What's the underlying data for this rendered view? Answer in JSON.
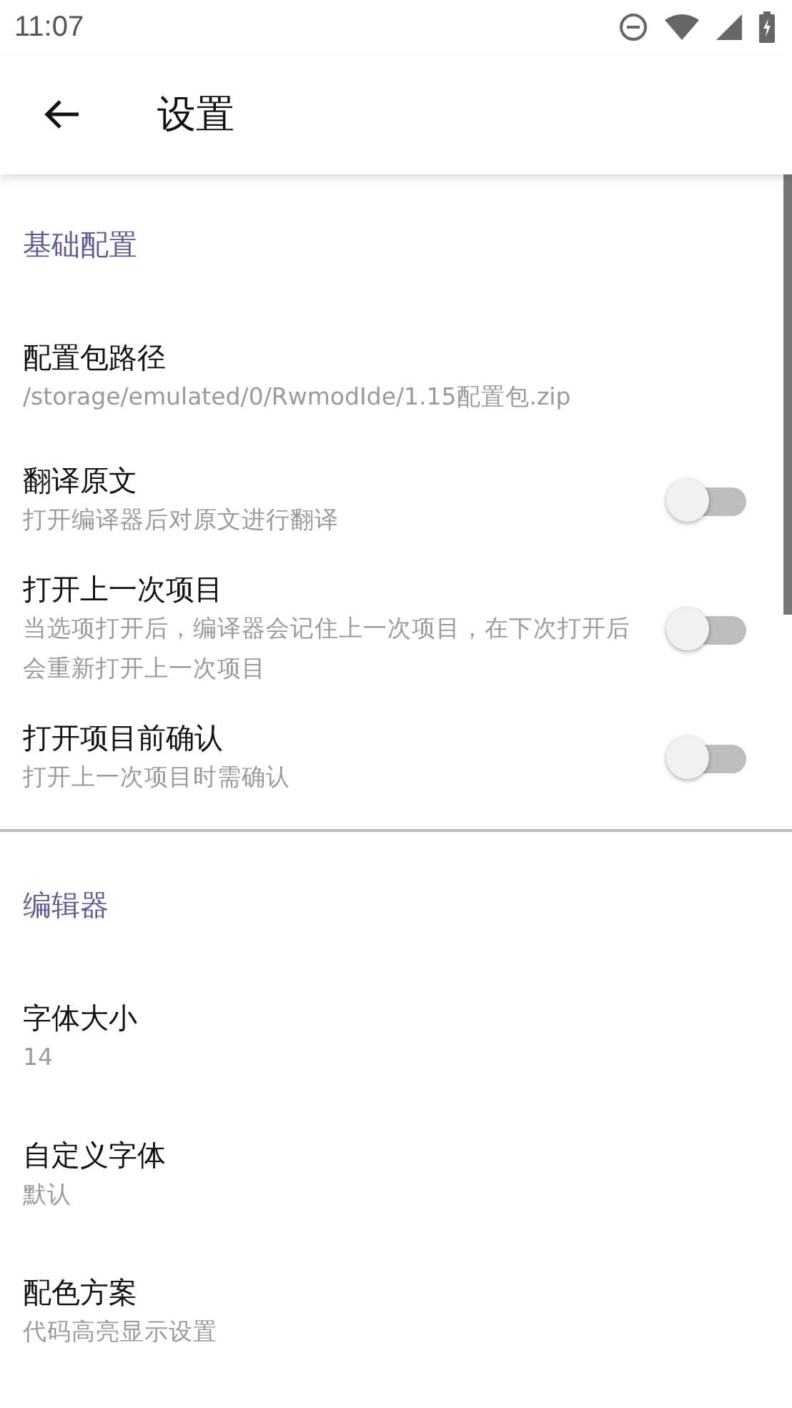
{
  "status_bar": {
    "time": "11:07"
  },
  "app_bar": {
    "title": "设置"
  },
  "sections": [
    {
      "title": "基础配置",
      "items": [
        {
          "kind": "text",
          "title": "配置包路径",
          "summary": "/storage/emulated/0/RwmodIde/1.15配置包.zip"
        },
        {
          "kind": "switch",
          "title": "翻译原文",
          "summary": "打开编译器后对原文进行翻译",
          "on": false
        },
        {
          "kind": "switch",
          "title": "打开上一次项目",
          "summary": "当选项打开后，编译器会记住上一次项目，在下次打开后会重新打开上一次项目",
          "on": false
        },
        {
          "kind": "switch",
          "title": "打开项目前确认",
          "summary": "打开上一次项目时需确认",
          "on": false
        }
      ]
    },
    {
      "title": "编辑器",
      "items": [
        {
          "kind": "text",
          "title": "字体大小",
          "summary": "14"
        },
        {
          "kind": "text",
          "title": "自定义字体",
          "summary": "默认"
        },
        {
          "kind": "text",
          "title": "配色方案",
          "summary": "代码高亮显示设置"
        }
      ]
    }
  ]
}
